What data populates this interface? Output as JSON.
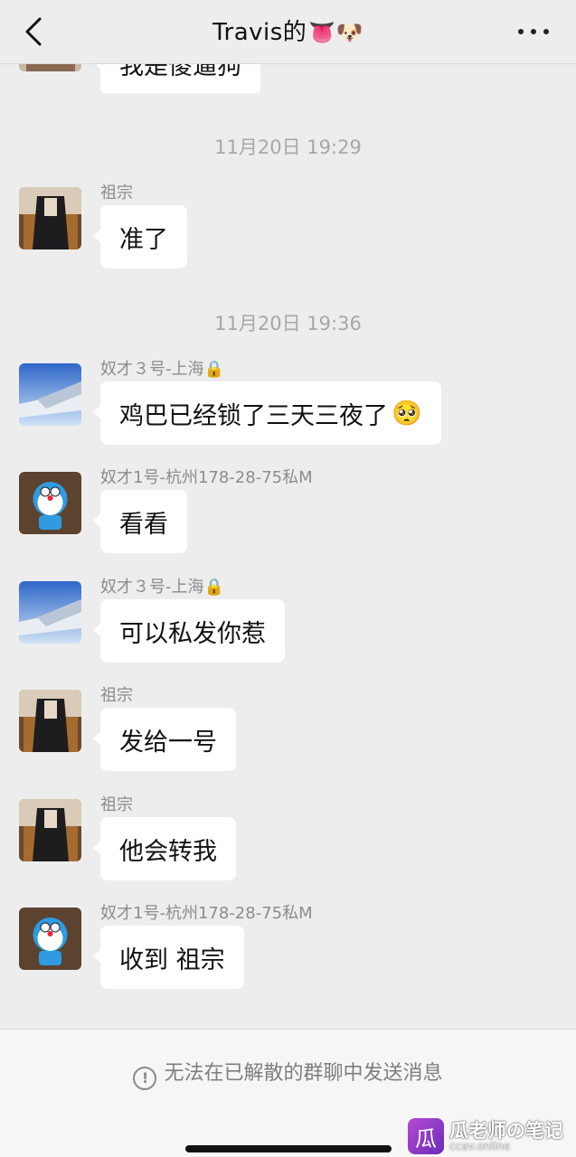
{
  "header": {
    "title": "Travis的",
    "title_emoji": "👅🐶"
  },
  "partial_message": {
    "text": "我是傻逼狗"
  },
  "timestamps": [
    "11月20日 19:29",
    "11月20日 19:36"
  ],
  "messages": [
    {
      "sender": "祖宗",
      "text": "准了"
    },
    {
      "sender": "奴才３号-上海🔒",
      "text": "鸡巴已经锁了三天三夜了",
      "emoji": "🥺"
    },
    {
      "sender": "奴才1号-杭州178-28-75私M",
      "text": "看看"
    },
    {
      "sender": "奴才３号-上海🔒",
      "text": "可以私发你惹"
    },
    {
      "sender": "祖宗",
      "text": "发给一号"
    },
    {
      "sender": "祖宗",
      "text": "他会转我"
    },
    {
      "sender": "奴才1号-杭州178-28-75私M",
      "text": "收到 祖宗"
    }
  ],
  "footer": {
    "notice": "无法在已解散的群聊中发送消息",
    "notice_icon": "!",
    "watermark_logo": "瓜",
    "watermark_title": "瓜老师の笔记",
    "watermark_sub": "ccav.online"
  },
  "icons": {
    "back": "chevron-left-icon",
    "more": "more-dots-icon",
    "notice": "info-circle-icon"
  },
  "colors": {
    "background": "#ededed",
    "bubble": "#ffffff",
    "timestamp": "#a7a7a7",
    "sender": "#8c8c8c"
  }
}
